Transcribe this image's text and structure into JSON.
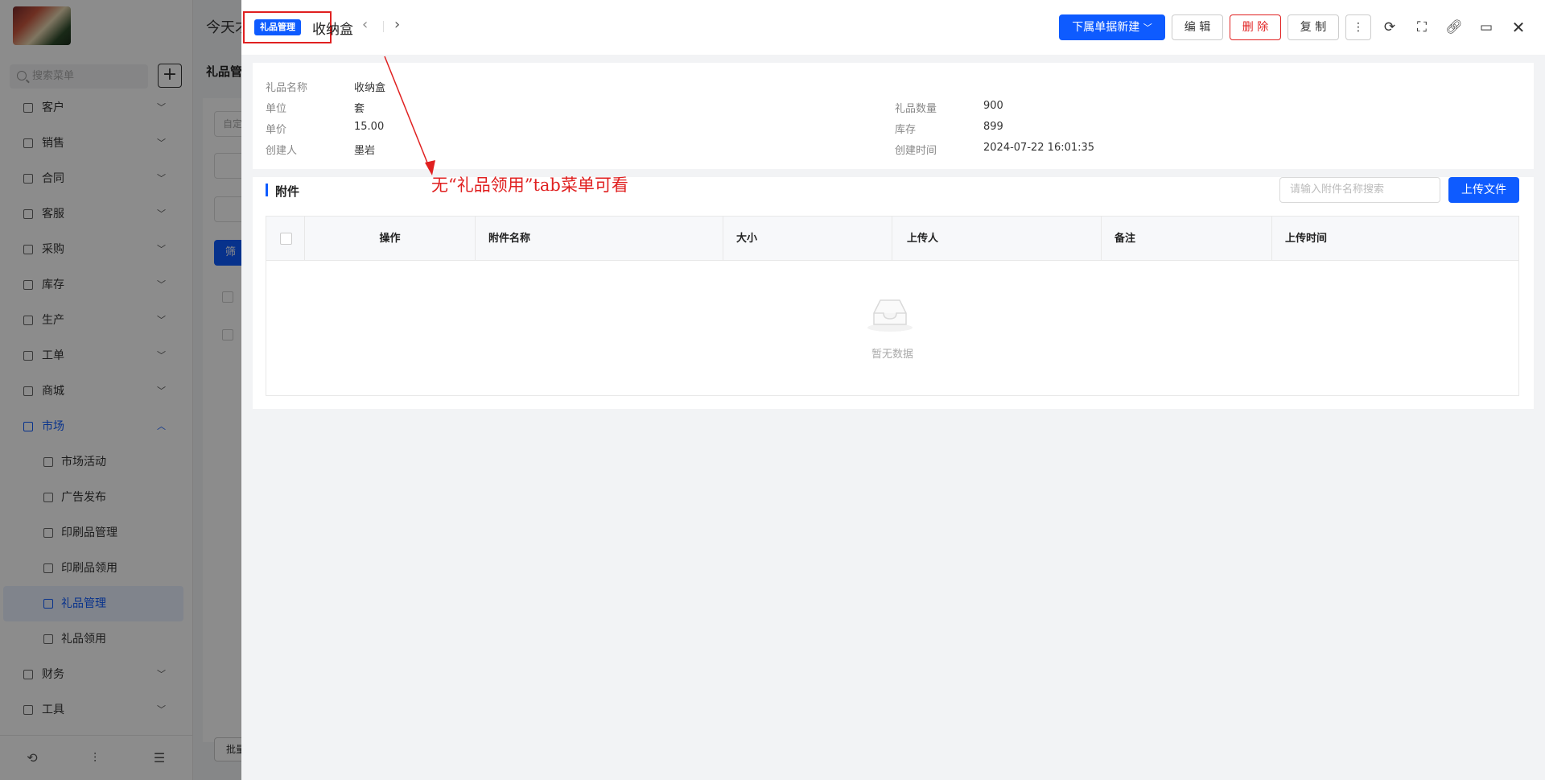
{
  "background": {
    "sidebar": {
      "search_placeholder": "搜索菜单",
      "add_label": "+",
      "menu": [
        {
          "label": "客户",
          "state": "collapsed"
        },
        {
          "label": "销售",
          "state": "collapsed"
        },
        {
          "label": "合同",
          "state": "collapsed"
        },
        {
          "label": "客服",
          "state": "collapsed"
        },
        {
          "label": "采购",
          "state": "collapsed"
        },
        {
          "label": "库存",
          "state": "collapsed"
        },
        {
          "label": "生产",
          "state": "collapsed"
        },
        {
          "label": "工单",
          "state": "collapsed"
        },
        {
          "label": "商城",
          "state": "collapsed"
        },
        {
          "label": "市场",
          "state": "expanded"
        }
      ],
      "market_sub": [
        {
          "label": "市场活动"
        },
        {
          "label": "广告发布"
        },
        {
          "label": "印刷品管理"
        },
        {
          "label": "印刷品领用"
        },
        {
          "label": "礼品管理",
          "active": true
        },
        {
          "label": "礼品领用"
        }
      ],
      "menu_after": [
        {
          "label": "财务"
        },
        {
          "label": "工具"
        }
      ]
    },
    "top_text": "今天才",
    "page_title": "礼品管",
    "input_hint": "自定",
    "filter_btn": "筛",
    "batch_btn": "批量"
  },
  "drawer": {
    "tag": "礼品管理",
    "title": "收纳盒",
    "buttons": {
      "new_sub": "下属单据新建",
      "edit": "编 辑",
      "delete": "删 除",
      "copy": "复 制"
    },
    "icons": [
      "more-vertical-icon",
      "refresh-icon",
      "fullscreen-icon",
      "link-icon",
      "laptop-icon",
      "close-icon"
    ],
    "info": {
      "name_label": "礼品名称",
      "name_value": "收纳盒",
      "unit_label": "单位",
      "unit_value": "套",
      "price_label": "单价",
      "price_value": "15.00",
      "creator_label": "创建人",
      "creator_value": "墨岩",
      "qty_label": "礼品数量",
      "qty_value": "900",
      "stock_label": "库存",
      "stock_value": "899",
      "created_label": "创建时间",
      "created_value": "2024-07-22 16:01:35"
    },
    "attachments": {
      "title": "附件",
      "search_placeholder": "请输入附件名称搜索",
      "upload_label": "上传文件",
      "columns": [
        "操作",
        "附件名称",
        "大小",
        "上传人",
        "备注",
        "上传时间"
      ],
      "empty_text": "暂无数据"
    }
  },
  "annotation": {
    "text": "无“礼品领用”tab菜单可看",
    "color": "#e02020"
  },
  "colors": {
    "primary": "#0e5bff",
    "danger": "#e02020"
  }
}
